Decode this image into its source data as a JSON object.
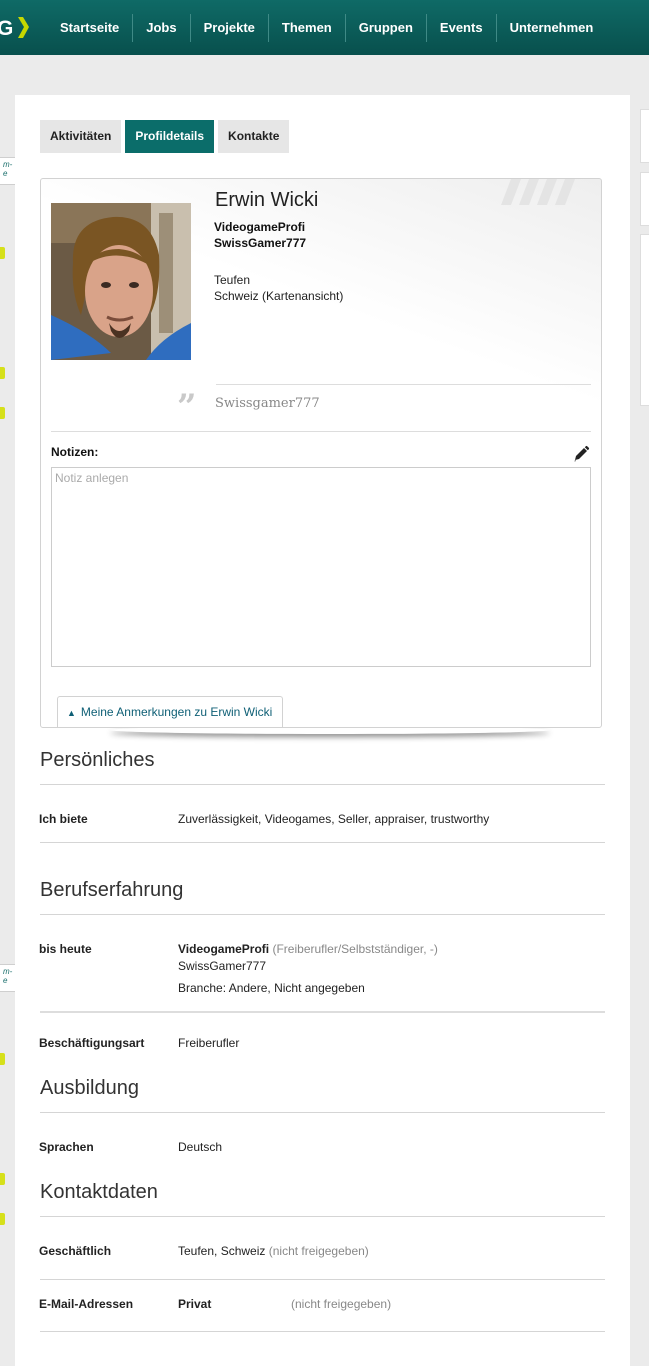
{
  "nav": {
    "items": [
      "Startseite",
      "Jobs",
      "Projekte",
      "Themen",
      "Gruppen",
      "Events",
      "Unternehmen"
    ]
  },
  "left_edge": {
    "bubble_text": "m-\ne"
  },
  "tabs": [
    {
      "label": "Aktivitäten",
      "active": false
    },
    {
      "label": "Profildetails",
      "active": true
    },
    {
      "label": "Kontakte",
      "active": false
    }
  ],
  "profile": {
    "name": "Erwin Wicki",
    "title": "VideogameProfi",
    "company": "SwissGamer777",
    "city": "Teufen",
    "country": "Schweiz (Kartenansicht)",
    "quote_mark": "”",
    "quote": "Swissgamer777",
    "notes_label": "Notizen:",
    "notes_placeholder": "Notiz anlegen",
    "notes_toggle": "Meine Anmerkungen zu Erwin Wicki"
  },
  "personal": {
    "heading": "Persönliches",
    "offer_label": "Ich biete",
    "offer_value": "Zuverlässigkeit, Videogames, Seller, appraiser, trustworthy"
  },
  "experience": {
    "heading": "Berufserfahrung",
    "period": "bis heute",
    "job_title": "VideogameProfi",
    "job_type": "(Freiberufler/Selbstständiger, -)",
    "company": "SwissGamer777",
    "industry": "Branche: Andere, Nicht angegeben",
    "employment_label": "Beschäftigungsart",
    "employment_value": "Freiberufler"
  },
  "education": {
    "heading": "Ausbildung",
    "languages_label": "Sprachen",
    "languages_value": "Deutsch"
  },
  "contact": {
    "heading": "Kontaktdaten",
    "business_label": "Geschäftlich",
    "business_value": "Teufen, Schweiz",
    "business_note": "(nicht freigegeben)",
    "email_label": "E-Mail-Adressen",
    "email_kind": "Privat",
    "email_note": "(nicht freigegeben)"
  },
  "colors": {
    "brand": "#0b6d6a",
    "accent": "#c6d800",
    "link": "#0e5f75"
  }
}
